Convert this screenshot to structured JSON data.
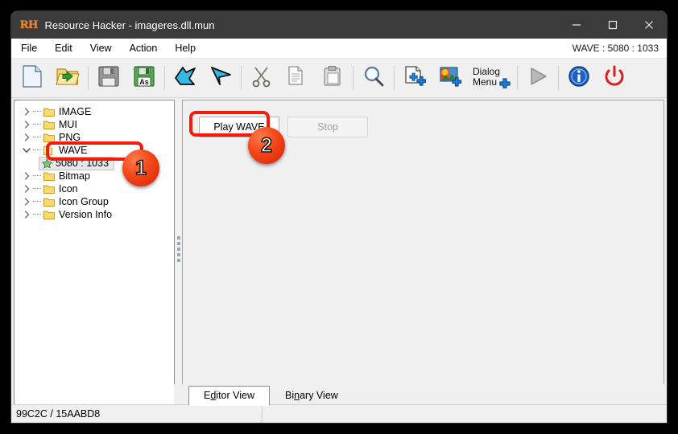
{
  "window": {
    "logo": "RH",
    "title": "Resource Hacker - imageres.dll.mun",
    "controls": {
      "minimize": "minimize-button",
      "maximize": "maximize-button",
      "close": "close-button"
    }
  },
  "menubar": {
    "items": [
      "File",
      "Edit",
      "View",
      "Action",
      "Help"
    ],
    "right_info": "WAVE : 5080 : 1033"
  },
  "toolbar": {
    "buttons": [
      {
        "name": "new-file-icon",
        "label": "New"
      },
      {
        "name": "open-file-icon",
        "label": "Open"
      },
      {
        "name": "save-icon",
        "label": "Save"
      },
      {
        "name": "save-as-icon",
        "label": "Save As"
      },
      {
        "name": "compile-script-icon",
        "label": "Compile Script"
      },
      {
        "name": "view-resource-icon",
        "label": "View Resource"
      },
      {
        "name": "cut-icon",
        "label": "Cut"
      },
      {
        "name": "copy-icon",
        "label": "Copy"
      },
      {
        "name": "paste-icon",
        "label": "Paste"
      },
      {
        "name": "find-icon",
        "label": "Find"
      },
      {
        "name": "add-binary-resource-icon",
        "label": "Add Binary Resource"
      },
      {
        "name": "add-image-resource-icon",
        "label": "Add Image Resource"
      },
      {
        "name": "add-dialog-menu-icon",
        "label": "Dialog Menu"
      },
      {
        "name": "run-icon",
        "label": "Run"
      },
      {
        "name": "about-icon",
        "label": "About"
      },
      {
        "name": "exit-icon",
        "label": "Exit"
      }
    ],
    "dialog_label_line1": "Dialog",
    "dialog_label_line2": "Menu"
  },
  "tree": {
    "nodes": [
      {
        "label": "IMAGE",
        "expanded": false,
        "type": "folder"
      },
      {
        "label": "MUI",
        "expanded": false,
        "type": "folder"
      },
      {
        "label": "PNG",
        "expanded": false,
        "type": "folder"
      },
      {
        "label": "WAVE",
        "expanded": true,
        "type": "folder"
      },
      {
        "label": "5080 : 1033",
        "expanded": false,
        "type": "leaf",
        "selected": true
      },
      {
        "label": "Bitmap",
        "expanded": false,
        "type": "folder"
      },
      {
        "label": "Icon",
        "expanded": false,
        "type": "folder"
      },
      {
        "label": "Icon Group",
        "expanded": false,
        "type": "folder"
      },
      {
        "label": "Version Info",
        "expanded": false,
        "type": "folder"
      }
    ]
  },
  "content": {
    "play_button": "Play WAVE",
    "stop_button": "Stop"
  },
  "tabs": [
    {
      "prefix": "E",
      "accel": "d",
      "suffix": "itor View",
      "active": true
    },
    {
      "prefix": "Bi",
      "accel": "n",
      "suffix": "ary View",
      "active": false
    }
  ],
  "statusbar": {
    "offset_size": "99C2C / 15AABD8",
    "second_cell": ""
  },
  "annotations": {
    "badges": [
      {
        "number": "1",
        "target": "tree-selected-item"
      },
      {
        "number": "2",
        "target": "play-wave-button"
      }
    ],
    "highlight_color": "#f41b0c"
  }
}
